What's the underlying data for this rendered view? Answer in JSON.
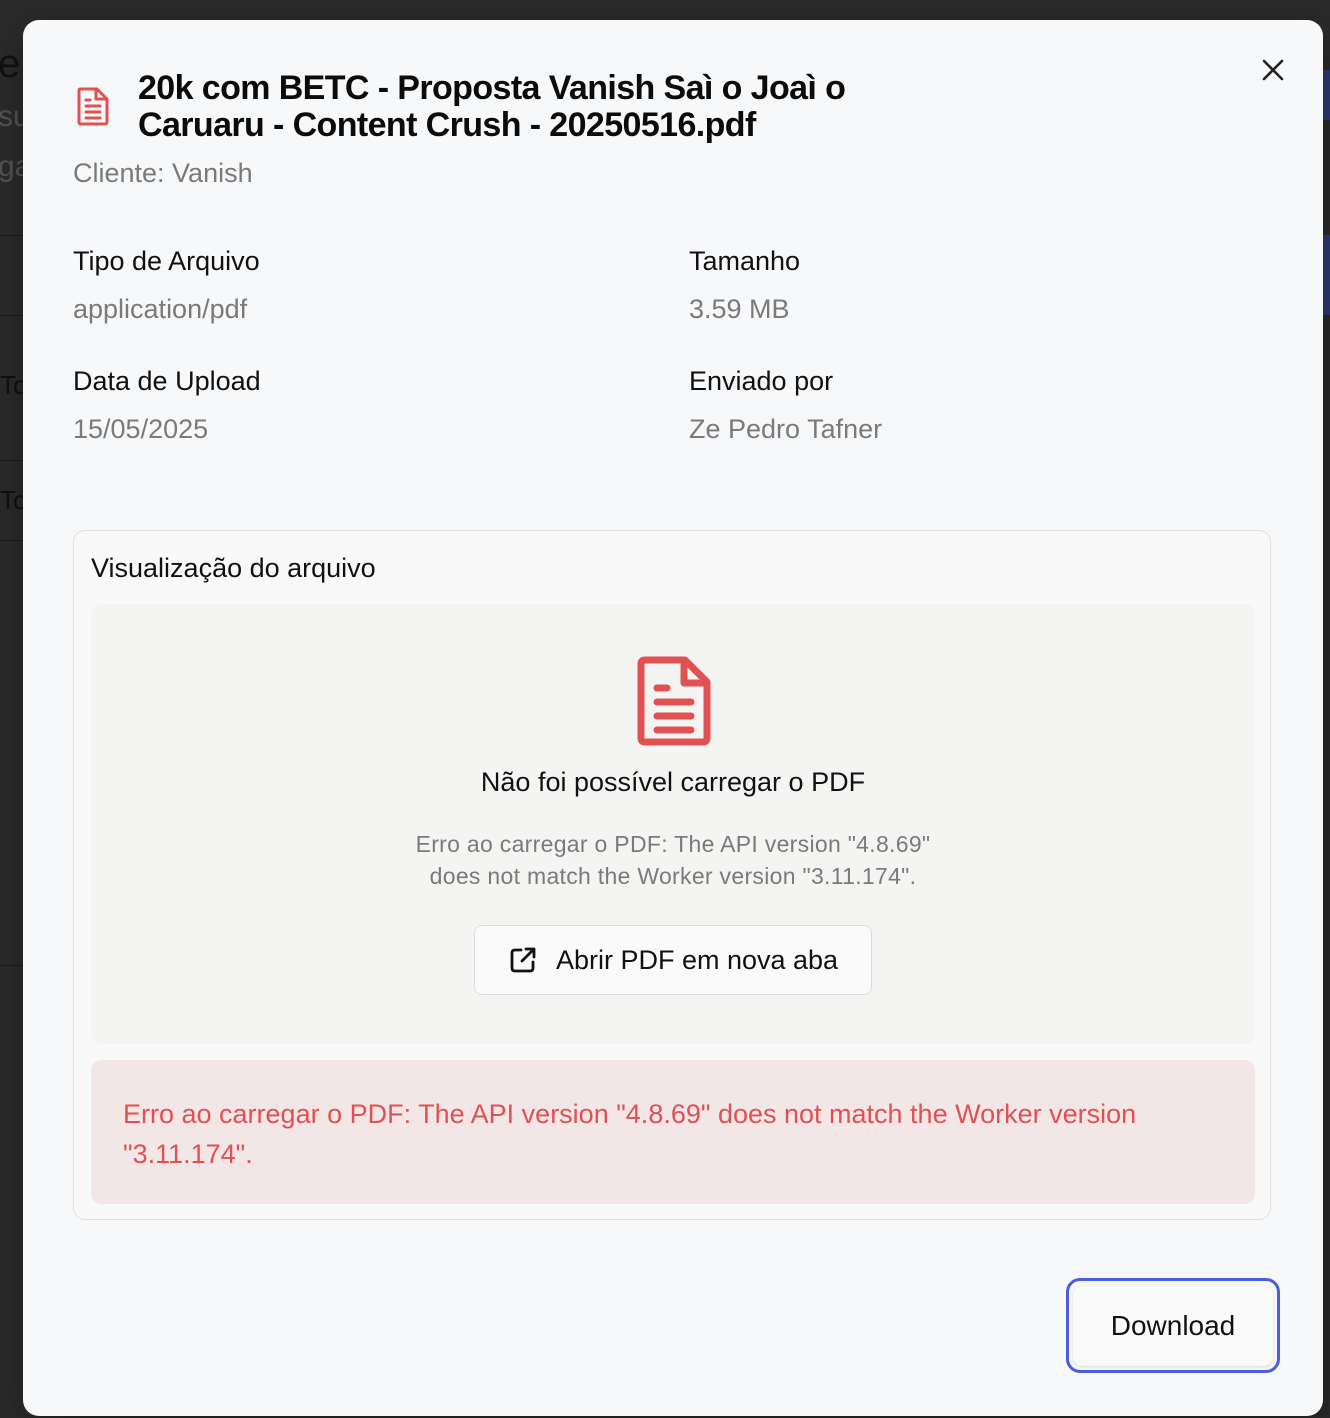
{
  "background": {
    "fragments": [
      "e",
      "su",
      "ga",
      "To",
      "To"
    ]
  },
  "modal": {
    "title": "20k com BETC - Proposta Vanish Saì    o Joaì    o\nCaruaru - Content Crush - 20250516.pdf",
    "subtitle": "Cliente: Vanish",
    "file_icon": "file-text-icon",
    "close_icon": "close-icon",
    "fields": {
      "file_type": {
        "label": "Tipo de Arquivo",
        "value": "application/pdf"
      },
      "size": {
        "label": "Tamanho",
        "value": "3.59 MB"
      },
      "upload_date": {
        "label": "Data de Upload",
        "value": "15/05/2025"
      },
      "uploaded_by": {
        "label": "Enviado por",
        "value": "Ze Pedro Tafner"
      }
    },
    "preview": {
      "title": "Visualização do arquivo",
      "fail_message": "Não foi possível carregar o PDF",
      "error_detail": "Erro ao carregar o PDF: The API version \"4.8.69\" does not match the Worker version \"3.11.174\".",
      "open_button_label": "Abrir PDF em nova aba",
      "open_button_icon": "external-link-icon"
    },
    "error_banner": "Erro ao carregar o PDF: The API version \"4.8.69\" does not match the Worker version \"3.11.174\".",
    "download_label": "Download"
  },
  "colors": {
    "accent_red": "#e05252",
    "focus_ring": "#4a5de0",
    "error_bg": "#f3e6e7"
  }
}
